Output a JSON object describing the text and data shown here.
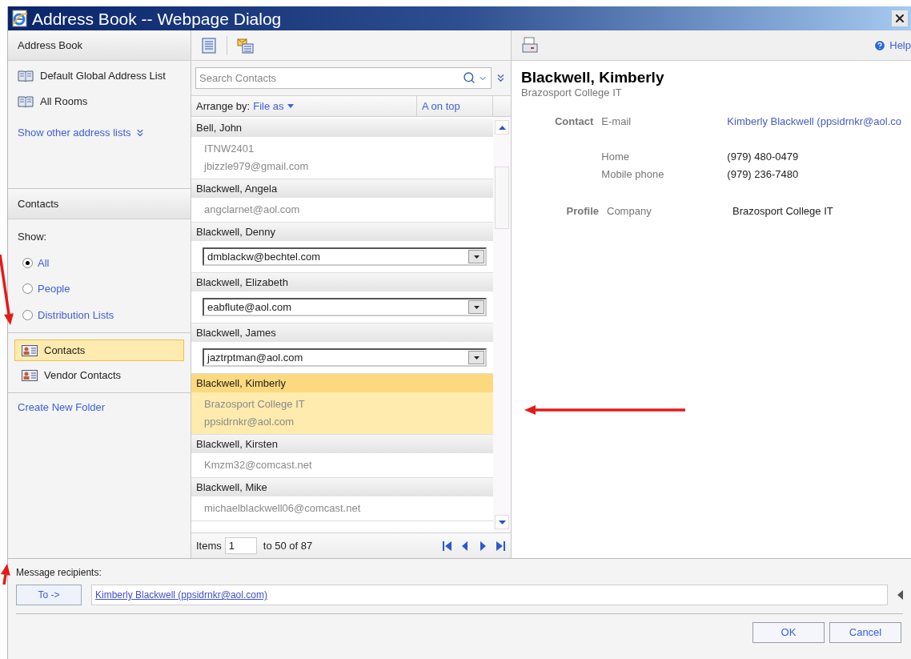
{
  "window": {
    "title": "Address Book -- Webpage Dialog"
  },
  "address_book": {
    "header": "Address Book",
    "lists": [
      "Default Global Address List",
      "All Rooms"
    ],
    "more_link": "Show other address lists"
  },
  "contacts_section": {
    "header": "Contacts",
    "show_label": "Show:",
    "filters": [
      {
        "label": "All",
        "selected": true
      },
      {
        "label": "People",
        "selected": false
      },
      {
        "label": "Distribution Lists",
        "selected": false
      }
    ],
    "folders": [
      {
        "label": "Contacts",
        "selected": true
      },
      {
        "label": "Vendor Contacts",
        "selected": false
      }
    ],
    "create_link": "Create New Folder"
  },
  "search": {
    "placeholder": "Search Contacts"
  },
  "arrange": {
    "label": "Arrange by:",
    "value": "File as",
    "sort": "A on top"
  },
  "contacts": [
    {
      "name": "Bell, John",
      "kind": "text",
      "selected": false,
      "details": [
        "ITNW2401",
        "jbizzle979@gmail.com"
      ]
    },
    {
      "name": "Blackwell, Angela",
      "kind": "text",
      "selected": false,
      "details": [
        "angclarnet@aol.com"
      ]
    },
    {
      "name": "Blackwell, Denny",
      "kind": "dropdown",
      "selected": false,
      "details": [
        "dmblackw@bechtel.com"
      ]
    },
    {
      "name": "Blackwell, Elizabeth",
      "kind": "dropdown",
      "selected": false,
      "details": [
        "eabflute@aol.com"
      ]
    },
    {
      "name": "Blackwell, James",
      "kind": "dropdown",
      "selected": false,
      "details": [
        "jaztrptman@aol.com"
      ]
    },
    {
      "name": "Blackwell, Kimberly",
      "kind": "text",
      "selected": true,
      "details": [
        "Brazosport College IT",
        "ppsidrnkr@aol.com"
      ]
    },
    {
      "name": "Blackwell, Kirsten",
      "kind": "text",
      "selected": false,
      "details": [
        "Kmzm32@comcast.net"
      ]
    },
    {
      "name": "Blackwell, Mike",
      "kind": "text",
      "selected": false,
      "details": [
        "michaelblackwell06@comcast.net"
      ]
    }
  ],
  "pager": {
    "label": "Items",
    "value": "1",
    "range": "to 50 of 87"
  },
  "details": {
    "help": "Help",
    "name": "Blackwell, Kimberly",
    "company": "Brazosport College IT",
    "sections": [
      {
        "heading": "Contact",
        "groups": [
          [
            {
              "label": "E-mail",
              "value": "Kimberly Blackwell (ppsidrnkr@aol.co",
              "kind": "link"
            }
          ],
          [
            {
              "label": "Home",
              "value": "(979) 480-0479",
              "kind": "text"
            },
            {
              "label": "Mobile phone",
              "value": "(979) 236-7480",
              "kind": "text"
            }
          ]
        ]
      },
      {
        "heading": "Profile",
        "groups": [
          [
            {
              "label": "Company",
              "value": "Brazosport College IT",
              "kind": "text"
            }
          ]
        ]
      }
    ]
  },
  "recipients": {
    "label": "Message recipients:",
    "to_button": "To ->",
    "entries": [
      "Kimberly Blackwell (ppsidrnkr@aol.com)"
    ]
  },
  "buttons": [
    "OK",
    "Cancel"
  ]
}
